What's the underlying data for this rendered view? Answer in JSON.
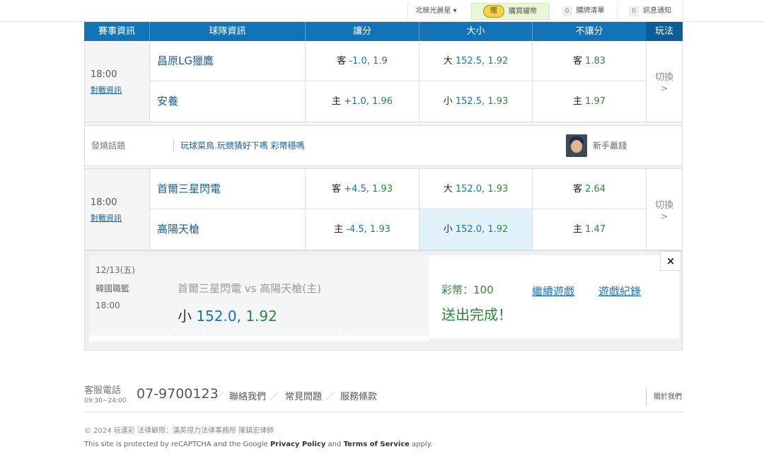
{
  "topbar": {
    "user": "北極光晨星 ▾",
    "buy_coin_icon": "贈",
    "buy": "購買罐幣",
    "cart_count": "0",
    "cart": "購牌清單",
    "msg_count": "0",
    "msg": "訊息通知"
  },
  "header": {
    "event": "賽事資訊",
    "team": "球隊資訊",
    "handicap": "讓分",
    "total": "大小",
    "moneyline": "不讓分",
    "play": "玩法"
  },
  "games": [
    {
      "time": "18:00",
      "info_link": "對戰資訊",
      "switch": "切換",
      "switch_arrow": ">",
      "rows": [
        {
          "team": "昌原LG獵鷹",
          "h_pfx": "客",
          "h_val": "-1.0,",
          "h_odds": "1.9",
          "t_pfx": "大",
          "t_val": "152.5,",
          "t_odds": "1.92",
          "m_pfx": "客",
          "m_odds": "1.83"
        },
        {
          "team": "安養",
          "h_pfx": "主",
          "h_val": "+1.0,",
          "h_odds": "1.96",
          "t_pfx": "小",
          "t_val": "152.5,",
          "t_odds": "1.93",
          "m_pfx": "主",
          "m_odds": "1.97"
        }
      ]
    },
    {
      "time": "18:00",
      "info_link": "對戰資訊",
      "switch": "切換",
      "switch_arrow": ">",
      "rows": [
        {
          "team": "首爾三星閃電",
          "h_pfx": "客",
          "h_val": "+4.5,",
          "h_odds": "1.93",
          "t_pfx": "大",
          "t_val": "152.0,",
          "t_odds": "1.93",
          "m_pfx": "客",
          "m_odds": "2.64"
        },
        {
          "team": "高陽天槍",
          "h_pfx": "主",
          "h_val": "-4.5,",
          "h_odds": "1.93",
          "t_pfx": "小",
          "t_val": "152.0,",
          "t_odds": "1.92",
          "m_pfx": "主",
          "m_odds": "1.47"
        }
      ]
    }
  ],
  "topic": {
    "label": "發燒話題",
    "text": "玩球菜鳥.玩競猜好下嗎 彩幣穩嗎",
    "user": "新手贏錢"
  },
  "confirm": {
    "date": "12/13(五)",
    "league": "韓國職籃",
    "time": "18:00",
    "match": "首爾三星閃電  vs  高陽天槍(主)",
    "pick_prefix": "小",
    "pick_line": "152.0,",
    "pick_odds": "1.92",
    "coins": "彩幣：100",
    "done": "送出完成！",
    "continue": "繼續遊戲",
    "record": "遊戲紀錄",
    "close": "×"
  },
  "footer": {
    "service": "客服電話",
    "hours": "09:30~24:00",
    "phone": "07-9700123",
    "contact": "聯絡我們",
    "faq": "常見問題",
    "terms": "服務條款",
    "slash": "／",
    "about": "關於我們",
    "copyright": "© 2024 玩運彩 法律顧問：漢英得力法律事務所 陳鎮宏律師",
    "recaptcha_pre": "This site is protected by reCAPTCHA and the Google",
    "privacy": "Privacy Policy",
    "and": "and",
    "tos": "Terms of Service",
    "apply": "apply."
  }
}
